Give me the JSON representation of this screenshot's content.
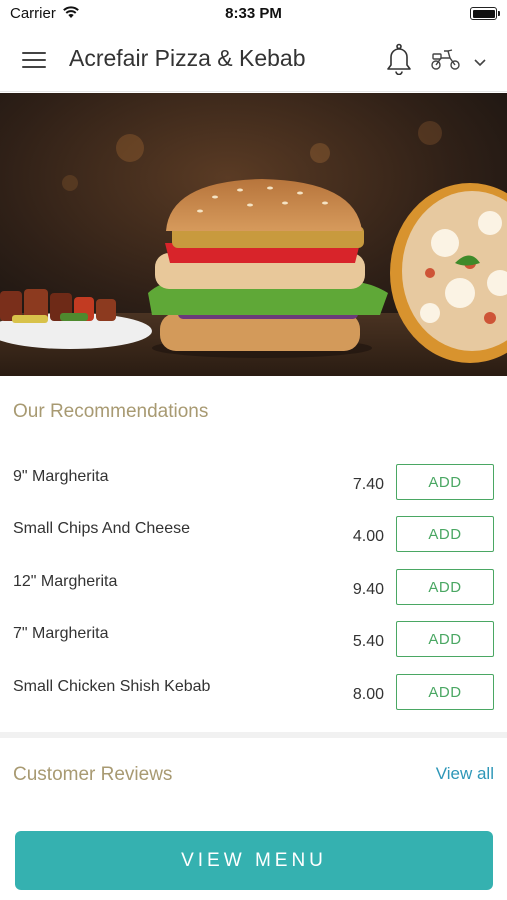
{
  "status_bar": {
    "carrier": "Carrier",
    "time": "8:33 PM"
  },
  "header": {
    "title": "Acrefair Pizza & Kebab",
    "icons": [
      "hamburger-menu-icon",
      "bell-icon",
      "scooter-icon",
      "chevron-down-icon"
    ]
  },
  "banner": {
    "image": "burger, pizza and kebab skewers food photo"
  },
  "recommendations": {
    "title": "Our Recommendations",
    "add_label": "ADD",
    "items": [
      {
        "name": "9\" Margherita",
        "price": "7.40"
      },
      {
        "name": "Small Chips And Cheese",
        "price": "4.00"
      },
      {
        "name": "12\" Margherita",
        "price": "9.40"
      },
      {
        "name": "7\" Margherita",
        "price": "5.40"
      },
      {
        "name": "Small Chicken Shish Kebab",
        "price": "8.00"
      }
    ]
  },
  "reviews": {
    "title": "Customer Reviews",
    "view_all": "View all"
  },
  "footer": {
    "view_menu": "VIEW MENU"
  },
  "colors": {
    "accent_teal": "#35b1b0",
    "add_green": "#4aa763",
    "section_title": "#a89a72",
    "link_blue": "#2e97b8"
  }
}
